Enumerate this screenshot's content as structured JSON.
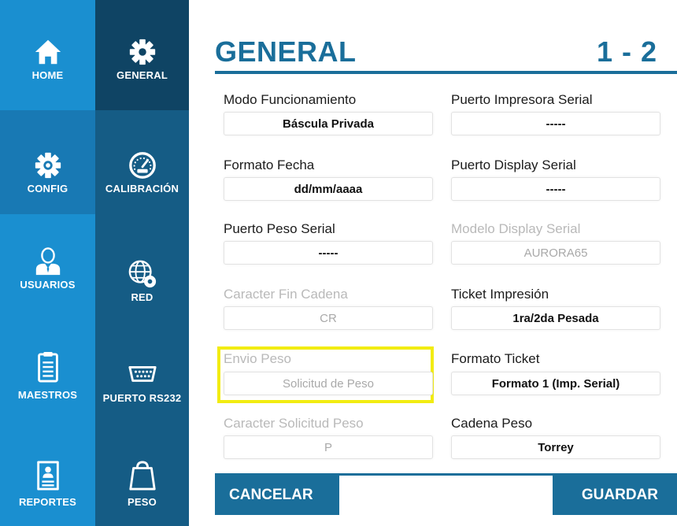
{
  "nav": {
    "home": "HOME",
    "general": "GENERAL",
    "config": "CONFIG",
    "calibracion": "CALIBRACIÓN",
    "usuarios": "USUARIOS",
    "red": "RED",
    "maestros": "MAESTROS",
    "puerto": "PUERTO RS232",
    "reportes": "REPORTES",
    "peso": "PESO"
  },
  "header": {
    "title": "GENERAL",
    "page": "1 - 2"
  },
  "form": {
    "modo_label": "Modo Funcionamiento",
    "modo_value": "Báscula Privada",
    "fecha_label": "Formato Fecha",
    "fecha_value": "dd/mm/aaaa",
    "peso_serial_label": "Puerto Peso Serial",
    "peso_serial_value": "-----",
    "fin_label": "Caracter Fin Cadena",
    "fin_value": "CR",
    "envio_label": "Envio Peso",
    "envio_value": "Solicitud de Peso",
    "solicitud_label": "Caracter Solicitud Peso",
    "solicitud_value": "P",
    "impresora_label": "Puerto Impresora Serial",
    "impresora_value": "-----",
    "display_label": "Puerto Display Serial",
    "display_value": "-----",
    "modelo_label": "Modelo Display Serial",
    "modelo_value": "AURORA65",
    "ticket_label": "Ticket Impresión",
    "ticket_value": "1ra/2da Pesada",
    "formato_ticket_label": "Formato Ticket",
    "formato_ticket_value": "Formato 1 (Imp. Serial)",
    "cadena_label": "Cadena Peso",
    "cadena_value": "Torrey"
  },
  "actions": {
    "cancel": "CANCELAR",
    "save": "GUARDAR"
  },
  "colors": {
    "nav_primary": "#1a8fd0",
    "nav_secondary": "#155c85",
    "nav_active": "#0f4464",
    "accent": "#1a6e9a",
    "highlight": "#f2ec12"
  }
}
